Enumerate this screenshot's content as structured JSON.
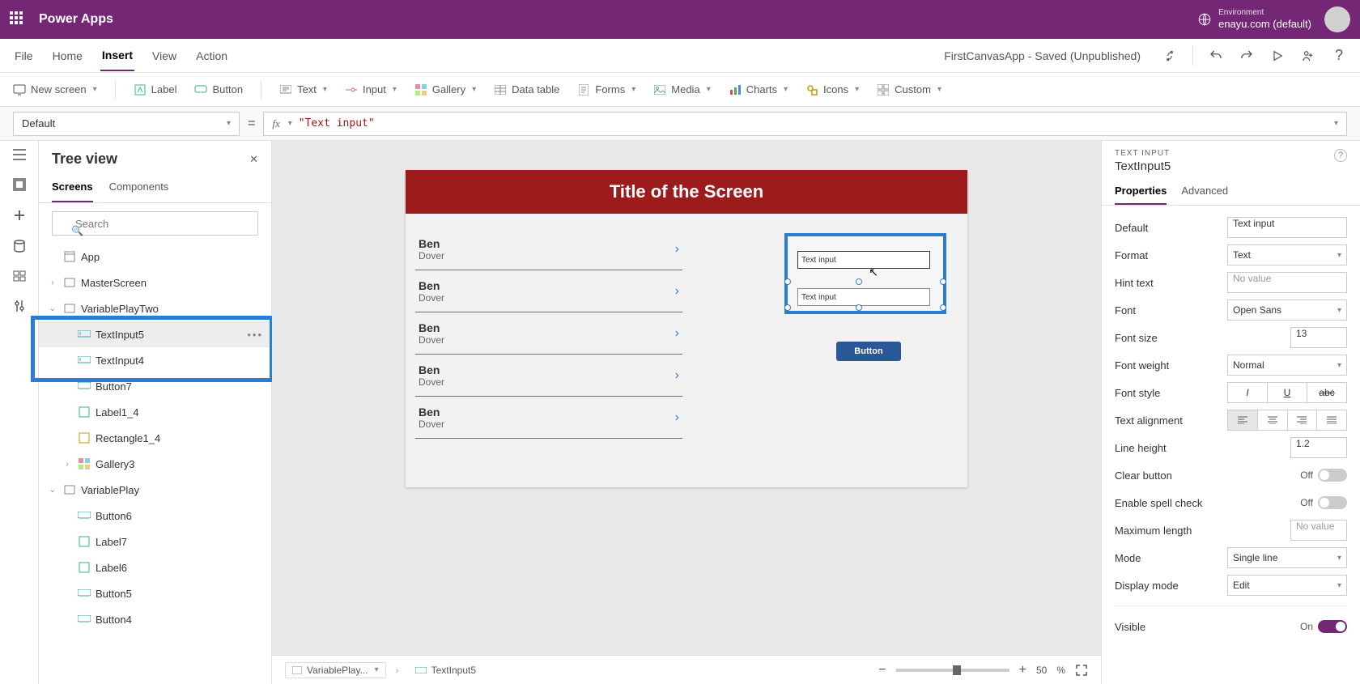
{
  "header": {
    "app_name": "Power Apps",
    "env_label": "Environment",
    "env_name": "enayu.com (default)"
  },
  "menubar": {
    "items": [
      "File",
      "Home",
      "Insert",
      "View",
      "Action"
    ],
    "active_index": 2,
    "doc_title": "FirstCanvasApp - Saved (Unpublished)"
  },
  "ribbon": {
    "new_screen": "New screen",
    "label": "Label",
    "button": "Button",
    "text": "Text",
    "input": "Input",
    "gallery": "Gallery",
    "data_table": "Data table",
    "forms": "Forms",
    "media": "Media",
    "charts": "Charts",
    "icons": "Icons",
    "custom": "Custom"
  },
  "formula": {
    "property": "Default",
    "fx": "fx",
    "value": "\"Text input\""
  },
  "tree": {
    "title": "Tree view",
    "tabs": [
      "Screens",
      "Components"
    ],
    "active_tab": 0,
    "search_placeholder": "Search",
    "nodes": {
      "app": "App",
      "master": "MasterScreen",
      "vpt": "VariablePlayTwo",
      "ti5": "TextInput5",
      "ti4": "TextInput4",
      "btn7": "Button7",
      "lbl14": "Label1_4",
      "rect14": "Rectangle1_4",
      "gal3": "Gallery3",
      "vp": "VariablePlay",
      "btn6": "Button6",
      "lbl7": "Label7",
      "lbl6": "Label6",
      "btn5": "Button5",
      "btn4": "Button4"
    }
  },
  "canvas": {
    "title": "Title of the Screen",
    "gallery": [
      {
        "name": "Ben",
        "sub": "Dover"
      },
      {
        "name": "Ben",
        "sub": "Dover"
      },
      {
        "name": "Ben",
        "sub": "Dover"
      },
      {
        "name": "Ben",
        "sub": "Dover"
      },
      {
        "name": "Ben",
        "sub": "Dover"
      }
    ],
    "text_input_val": "Text input",
    "button_label": "Button"
  },
  "status": {
    "crumb1": "VariablePlay...",
    "crumb2": "TextInput5",
    "zoom_value": "50",
    "zoom_pct": "%"
  },
  "props": {
    "type_label": "TEXT INPUT",
    "control_name": "TextInput5",
    "tabs": [
      "Properties",
      "Advanced"
    ],
    "active_tab": 0,
    "default_lbl": "Default",
    "default_val": "Text input",
    "format_lbl": "Format",
    "format_val": "Text",
    "hint_lbl": "Hint text",
    "hint_ph": "No value",
    "font_lbl": "Font",
    "font_val": "Open Sans",
    "fontsize_lbl": "Font size",
    "fontsize_val": "13",
    "fw_lbl": "Font weight",
    "fw_val": "Normal",
    "fstyle_lbl": "Font style",
    "talign_lbl": "Text alignment",
    "lh_lbl": "Line height",
    "lh_val": "1.2",
    "clear_lbl": "Clear button",
    "spell_lbl": "Enable spell check",
    "off_text": "Off",
    "on_text": "On",
    "maxlen_lbl": "Maximum length",
    "maxlen_ph": "No value",
    "mode_lbl": "Mode",
    "mode_val": "Single line",
    "dmode_lbl": "Display mode",
    "dmode_val": "Edit",
    "visible_lbl": "Visible"
  }
}
